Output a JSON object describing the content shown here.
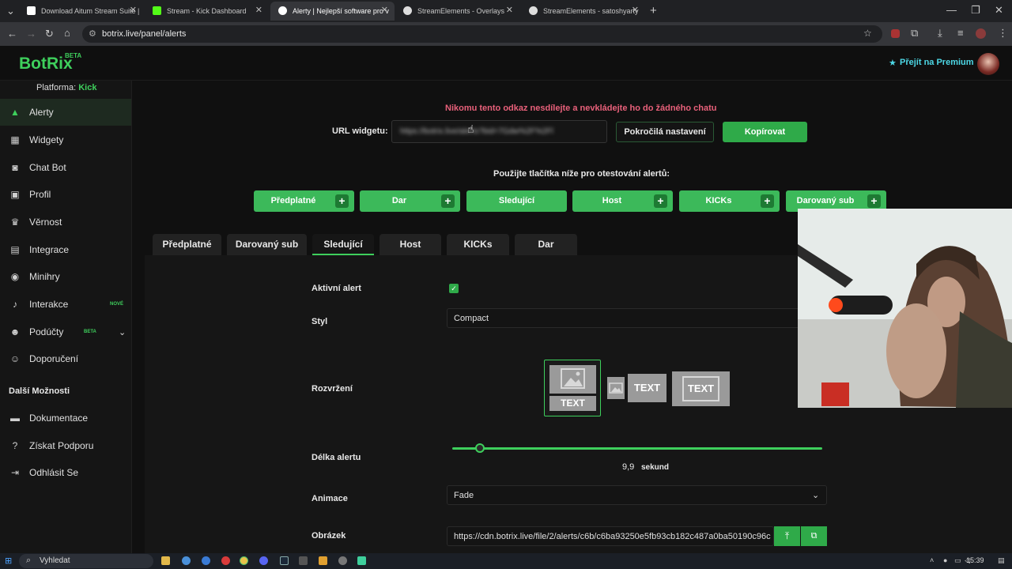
{
  "browser": {
    "tabs": [
      {
        "title": "Download Aitum Stream Suite |",
        "active": false
      },
      {
        "title": "Stream - Kick Dashboard",
        "active": false
      },
      {
        "title": "Alerty | Nejlepší software pro v",
        "active": true
      },
      {
        "title": "StreamElements - Overlays",
        "active": false
      },
      {
        "title": "StreamElements - satoshyarty",
        "active": false
      }
    ],
    "new_tab": "+",
    "url": "botrix.live/panel/alerts"
  },
  "app": {
    "logo": "BotRix",
    "logo_badge": "BETA",
    "premium_label": "Přejít na Premium",
    "platform_label": "Platforma:",
    "platform_value": "Kick"
  },
  "sidebar": {
    "items": [
      {
        "label": "Alerty",
        "icon": "warning-icon",
        "active": true
      },
      {
        "label": "Widgety",
        "icon": "widgets-icon"
      },
      {
        "label": "Chat Bot",
        "icon": "robot-icon"
      },
      {
        "label": "Profil",
        "icon": "id-card-icon"
      },
      {
        "label": "Věrnost",
        "icon": "trophy-icon"
      },
      {
        "label": "Integrace",
        "icon": "integration-icon"
      },
      {
        "label": "Minihry",
        "icon": "gamepad-icon"
      },
      {
        "label": "Interakce",
        "icon": "music-icon",
        "badge": "NOVÉ"
      },
      {
        "label": "Podúčty",
        "icon": "users-icon",
        "badge": "BETA"
      },
      {
        "label": "Doporučení",
        "icon": "referral-icon"
      }
    ],
    "section_title": "Další Možnosti",
    "more_items": [
      {
        "label": "Dokumentace",
        "icon": "book-icon"
      },
      {
        "label": "Získat Podporu",
        "icon": "help-icon"
      },
      {
        "label": "Odhlásit Se",
        "icon": "logout-icon"
      }
    ]
  },
  "main": {
    "warning": "Nikomu tento odkaz nesdílejte a nevkládejte ho do žádného chatu",
    "url_widget_label": "URL widgetu:",
    "url_widget_value": "https://botrix.live/alerts?bid=7Gdw%2F%2Fl",
    "advanced_button": "Pokročilá nastavení",
    "copy_button": "Kopírovat",
    "test_prompt": "Použijte tlačítka níže pro otestování alertů:",
    "test_buttons": [
      "Předplatné",
      "Dar",
      "Sledující",
      "Host",
      "KICKs",
      "Darovaný sub"
    ],
    "tabs": [
      "Předplatné",
      "Darovaný sub",
      "Sledující",
      "Host",
      "KICKs",
      "Dar"
    ],
    "active_tab": "Sledující",
    "fields": {
      "active_alert_label": "Aktivní alert",
      "style_label": "Styl",
      "style_value": "Compact",
      "layout_label": "Rozvržení",
      "layout_text": "TEXT",
      "length_label": "Délka alertu",
      "length_value": "9,9",
      "length_unit": "sekund",
      "length_fraction": 0.075,
      "animation_label": "Animace",
      "animation_value": "Fade",
      "image_label": "Obrázek",
      "image_value": "https://cdn.botrix.live/file/2/alerts/c6b/c6ba93250e5fb93cb182c487a0ba50190c96c"
    }
  },
  "taskbar": {
    "search_placeholder": "Vyhledat",
    "clock": "15:39"
  },
  "colors": {
    "accent_green": "#3ecf5c",
    "warning_red": "#e8607a",
    "premium_cyan": "#4dd8e6"
  }
}
